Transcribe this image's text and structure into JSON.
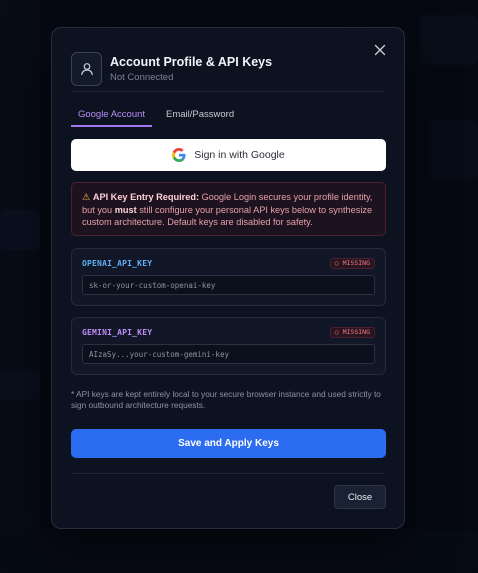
{
  "modal": {
    "title": "Account Profile & API Keys",
    "subtitle": "Not Connected"
  },
  "tabs": [
    {
      "label": "Google Account",
      "active": true
    },
    {
      "label": "Email/Password",
      "active": false
    }
  ],
  "google_signin": {
    "label": "Sign in with Google"
  },
  "warning": {
    "icon": "warning-triangle-icon",
    "heading": "API Key Entry Required:",
    "text_1": " Google Login secures your profile identity, but you ",
    "emphasis": "must",
    "text_2": " still configure your personal API keys below to synthesize custom architecture. Default keys are disabled for safety."
  },
  "keys": [
    {
      "name": "OPENAI_API_KEY",
      "status": "○ MISSING",
      "value": "",
      "placeholder": "sk-or-your-custom-openai-key"
    },
    {
      "name": "GEMINI_API_KEY",
      "status": "○ MISSING",
      "value": "",
      "placeholder": "AIzaSy...your-custom-gemini-key"
    }
  ],
  "note": "* API keys are kept entirely local to your secure browser instance and used strictly to sign outbound architecture requests.",
  "actions": {
    "save_label": "Save and Apply Keys",
    "close_label": "Close"
  },
  "colors": {
    "accent_purple": "#a875f2",
    "primary_blue": "#2c6cf0",
    "missing_red": "#f27b86",
    "openai_key_color": "#5fb0f5",
    "gemini_key_color": "#c08cf5"
  }
}
